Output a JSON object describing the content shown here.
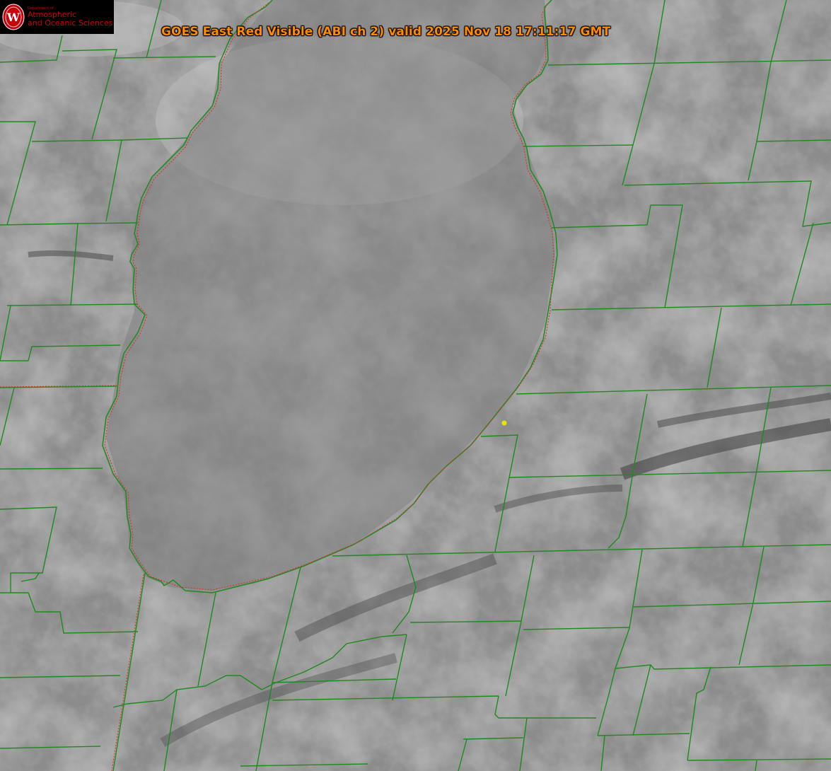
{
  "title": "GOES East Red Visible (ABI ch 2) valid 2025 Nov 18 17:11:17 GMT",
  "logo": {
    "department": "Department of",
    "line1": "Atmospheric",
    "line2": "and Oceanic Sciences",
    "seal_letter": "W"
  },
  "colors": {
    "boundary_green": "#1e8a1e",
    "state_line_red": "#e03030",
    "title_orange": "#ff8a00",
    "logo_red": "#c5050c",
    "marker_yellow": "#e6e600"
  }
}
